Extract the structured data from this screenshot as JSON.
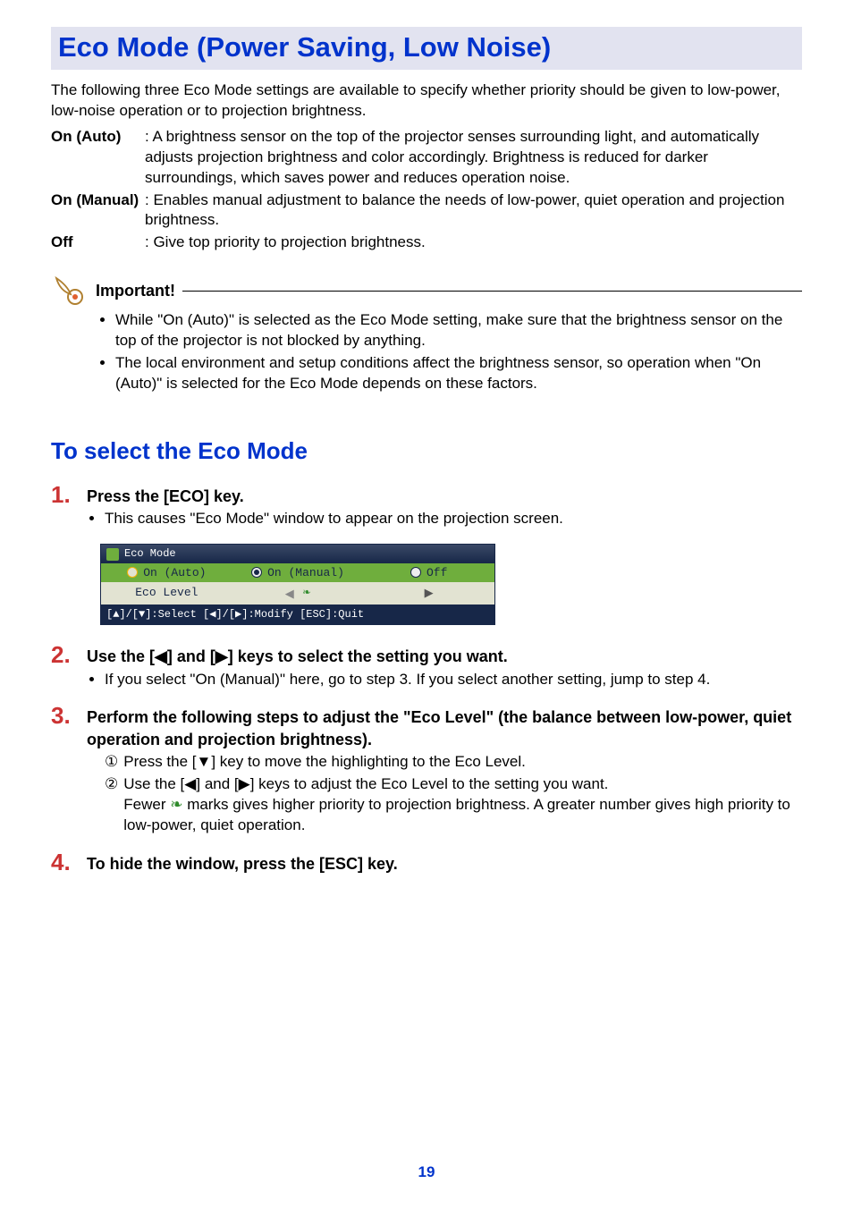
{
  "title": "Eco Mode (Power Saving, Low Noise)",
  "intro": "The following three Eco Mode settings are available to specify whether priority should be given to low-power, low-noise operation or to projection brightness.",
  "definitions": [
    {
      "term": "On (Auto)",
      "desc": ": A brightness sensor on the top of the projector senses surrounding light, and automatically adjusts projection brightness and color accordingly. Brightness is reduced for darker surroundings, which saves power and reduces operation noise."
    },
    {
      "term": "On (Manual)",
      "desc": ": Enables manual adjustment to balance the needs of low-power, quiet operation and projection brightness."
    },
    {
      "term": "Off",
      "desc": ": Give top priority to projection brightness."
    }
  ],
  "important": {
    "label": "Important!",
    "items": [
      "While \"On (Auto)\" is selected as the Eco Mode setting, make sure that the brightness sensor on the top of the projector is not blocked by anything.",
      "The local environment and setup conditions affect the brightness sensor, so operation when \"On (Auto)\" is selected for the Eco Mode depends on these factors."
    ]
  },
  "subheading": "To select the Eco Mode",
  "steps": {
    "s1": {
      "num": "1.",
      "title": "Press the [ECO] key.",
      "bullet": "This causes \"Eco Mode\" window to appear on the projection screen."
    },
    "s2": {
      "num": "2.",
      "title_pre": "Use the [",
      "title_mid": "] and [",
      "title_post": "] keys to select the setting you want.",
      "bullet": "If you select \"On (Manual)\" here, go to step 3. If you select another setting, jump to step 4."
    },
    "s3": {
      "num": "3.",
      "title": "Perform the following steps to adjust the \"Eco Level\" (the balance between low-power, quiet operation and projection brightness).",
      "sub1_num": "①",
      "sub1_pre": "Press the [",
      "sub1_post": "] key to move the highlighting to the Eco Level.",
      "sub2_num": "②",
      "sub2_pre": "Use the [",
      "sub2_mid": "] and [",
      "sub2_post": "] keys to adjust the Eco Level to the setting you want.",
      "sub2_extra_pre": "Fewer ",
      "sub2_extra_post": " marks gives higher priority to projection brightness. A greater number gives high priority to low-power, quiet operation."
    },
    "s4": {
      "num": "4.",
      "title": "To hide the window, press the [ESC] key."
    }
  },
  "screenshot": {
    "title": "Eco Mode",
    "options": [
      "On (Auto)",
      "On (Manual)",
      "Off"
    ],
    "selected_index": 1,
    "level_label": "Eco Level",
    "footer": "[▲]/[▼]:Select [◀]/[▶]:Modify [ESC]:Quit"
  },
  "page_number": "19"
}
